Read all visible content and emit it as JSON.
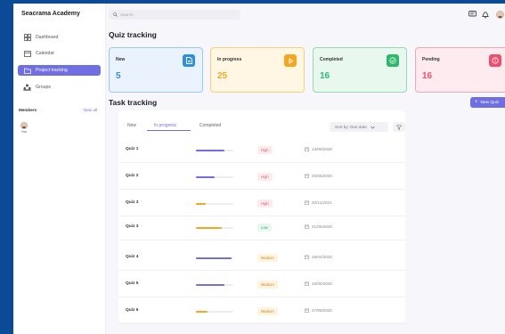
{
  "app": {
    "title": "Seacrama Academy"
  },
  "sidebar": {
    "items": [
      {
        "label": "Dashboard",
        "icon": "dashboard-icon"
      },
      {
        "label": "Calendar",
        "icon": "calendar-icon"
      },
      {
        "label": "Project tracking",
        "icon": "folder-icon",
        "active": true
      },
      {
        "label": "Groups",
        "icon": "groups-icon"
      }
    ],
    "members_title": "Members",
    "view_all": "View all",
    "member_name": "You"
  },
  "topbar": {
    "search_placeholder": "Search"
  },
  "quiz_tracking": {
    "title": "Quiz tracking",
    "cards": [
      {
        "label": "New",
        "value": "5",
        "color": "#2f8fdc",
        "bg": "#eaf3fd",
        "icon": "document-icon"
      },
      {
        "label": "In progress",
        "value": "25",
        "color": "#f5a524",
        "bg": "#fff6e3",
        "icon": "play-icon"
      },
      {
        "label": "Completed",
        "value": "16",
        "color": "#2db86b",
        "bg": "#e9f8ef",
        "icon": "check-icon"
      },
      {
        "label": "Pending",
        "value": "16",
        "color": "#ef4f6e",
        "bg": "#fdebef",
        "icon": "alert-icon"
      }
    ]
  },
  "task_tracking": {
    "title": "Task tracking",
    "new_quiz_label": "New Quiz",
    "tabs": [
      "New",
      "In progress",
      "Completed"
    ],
    "sort_label": "Sort by: Due date",
    "rows": [
      {
        "name": "Quiz 1",
        "progress": 0.75,
        "bar_color": "#6f6fe3",
        "priority": "High",
        "date": "13/06/2020"
      },
      {
        "name": "Quiz 2",
        "progress": 0.5,
        "bar_color": "#6f6fe3",
        "priority": "High",
        "date": "25/06/2020"
      },
      {
        "name": "Quiz 3",
        "progress": 0.25,
        "bar_color": "#f5a524",
        "priority": "High",
        "date": "20/11/2021"
      },
      {
        "name": "Quiz 3",
        "progress": 0.7,
        "bar_color": "#f5a524",
        "priority": "Low",
        "date": "21/05/2020"
      },
      {
        "name": "Quiz 4",
        "progress": 0.95,
        "bar_color": "#6f6fe3",
        "priority": "Medium",
        "date": "26/04/2020"
      },
      {
        "name": "Quiz 5",
        "progress": 0.75,
        "bar_color": "#6f6fe3",
        "priority": "Medium",
        "date": "16/05/2020"
      },
      {
        "name": "Quiz 6",
        "progress": 0.3,
        "bar_color": "#f5a524",
        "priority": "Medium",
        "date": "27/06/2020"
      }
    ]
  },
  "priority_colors": {
    "High": {
      "fg": "#e0556b",
      "bg": "#fdecef"
    },
    "Low": {
      "fg": "#2ea86a",
      "bg": "#e9f8ef"
    },
    "Medium": {
      "fg": "#c98a1c",
      "bg": "#fff4e0"
    }
  }
}
